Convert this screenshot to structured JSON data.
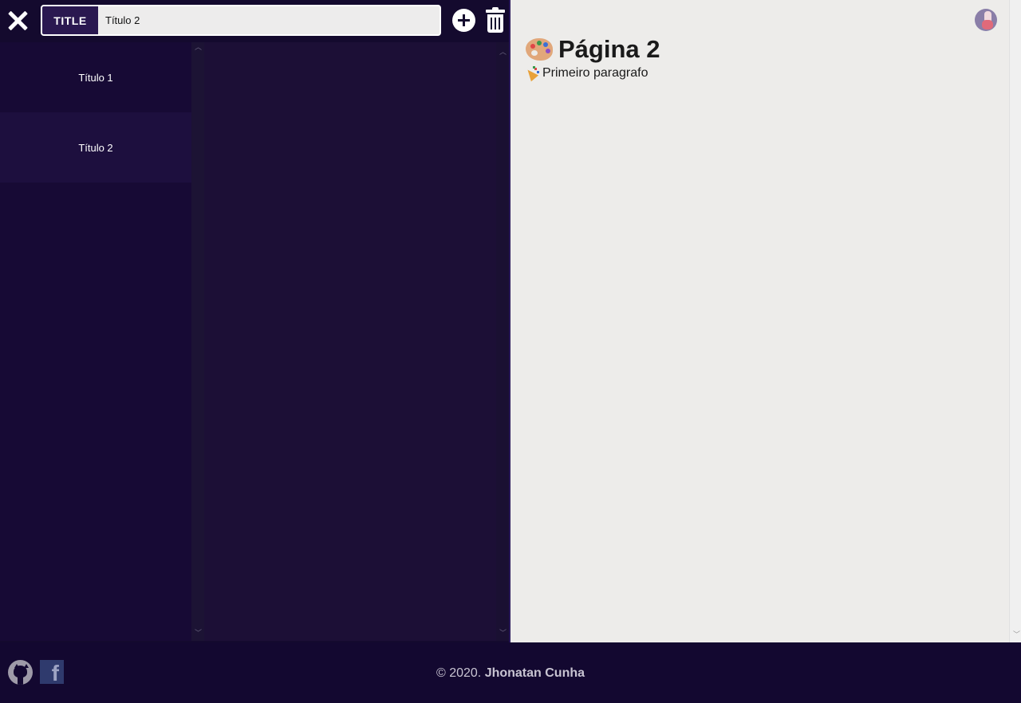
{
  "header": {
    "title_tag": "TITLE",
    "title_value": "Título 2"
  },
  "sidebar": {
    "items": [
      {
        "label": "Título 1",
        "active": false
      },
      {
        "label": "Título 2",
        "active": true
      }
    ]
  },
  "preview": {
    "heading": "Página 2",
    "heading_icon": "palette-emoji",
    "paragraph": "Primeiro paragrafo",
    "paragraph_icon": "party-popper-emoji"
  },
  "footer": {
    "copyright_prefix": "© 2020.",
    "author": "Jhonatan Cunha"
  },
  "colors": {
    "sidebar_bg": "#140a2e",
    "editor_bg": "#1c0f36",
    "preview_bg": "#edecea",
    "accent": "#2a1850"
  }
}
